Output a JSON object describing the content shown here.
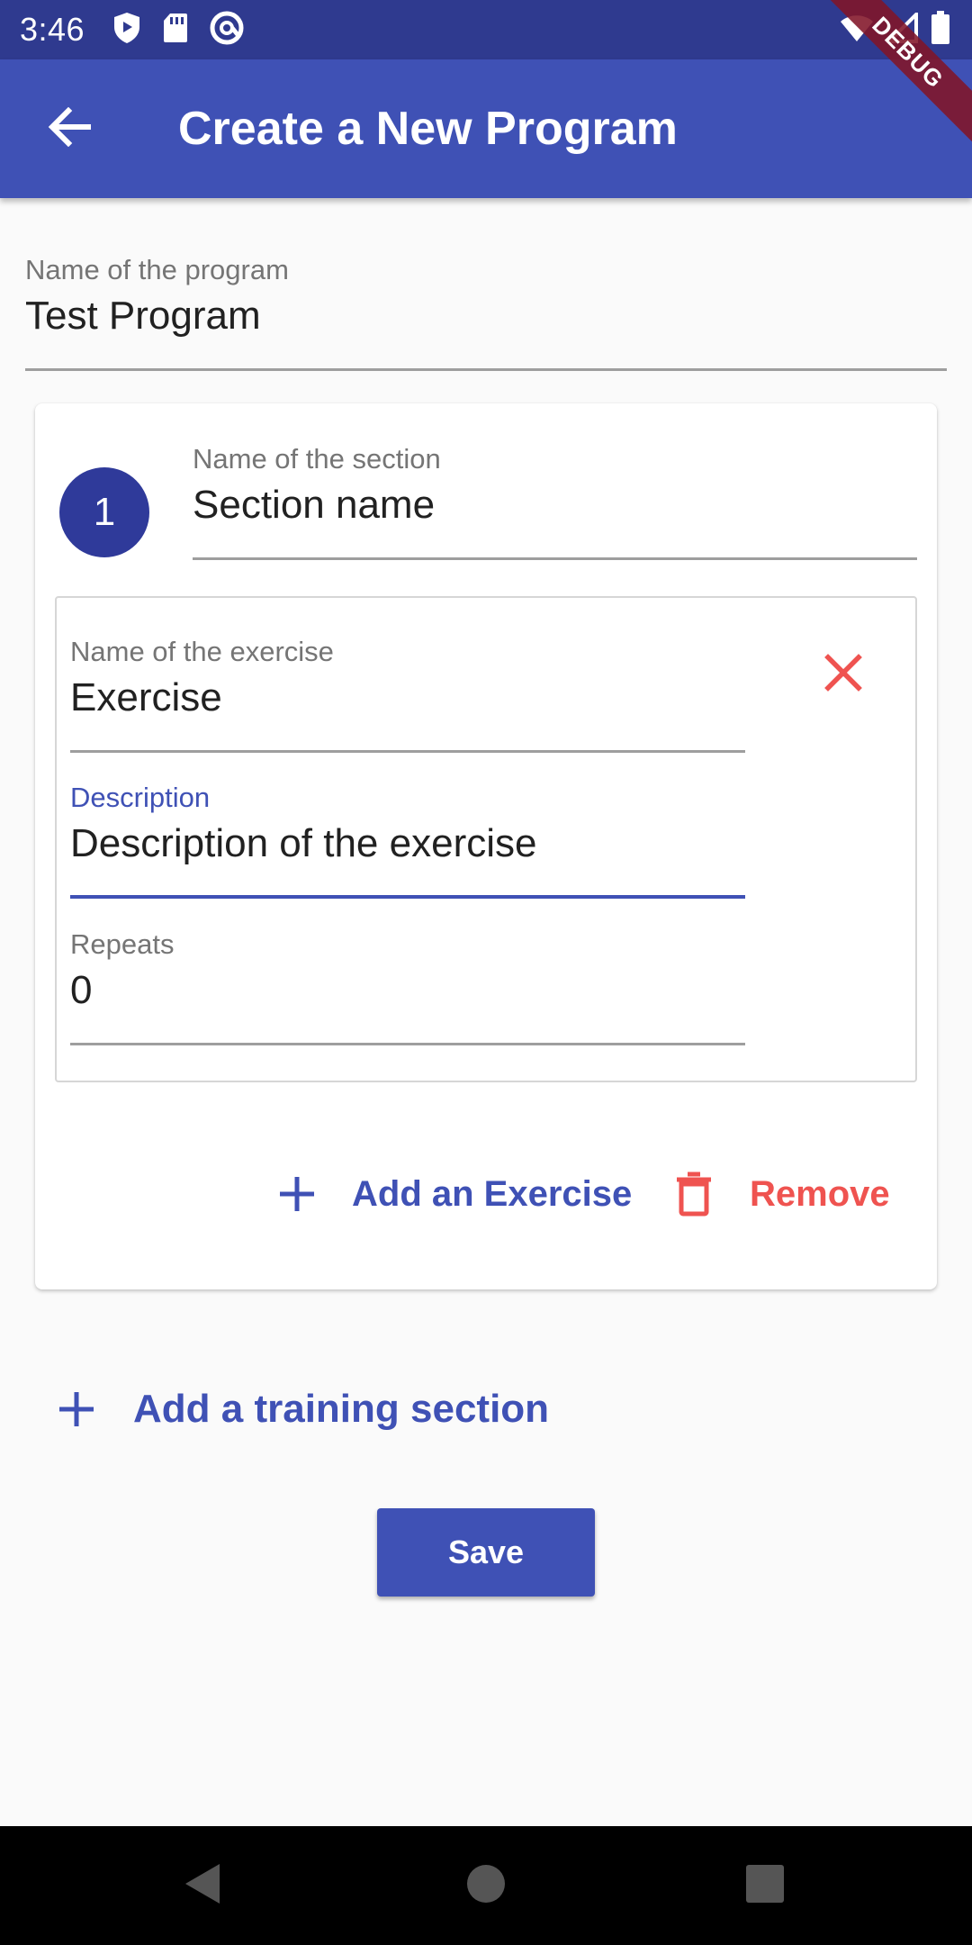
{
  "status_bar": {
    "time": "3:46",
    "left_icons": [
      "shield-icon",
      "sd-card-icon",
      "at-sign-icon"
    ],
    "right_icons": [
      "wifi-icon",
      "cell-signal-icon",
      "battery-icon"
    ]
  },
  "debug_banner": "DEBUG",
  "app_bar": {
    "title": "Create a New Program",
    "back_icon": "arrow-back-icon",
    "color": "#3f51b5"
  },
  "program": {
    "label": "Name of the program",
    "value": "Test Program"
  },
  "section": {
    "number": "1",
    "label": "Name of the section",
    "value": "Section name",
    "exercise": {
      "name_label": "Name of the exercise",
      "name_value": "Exercise",
      "description_label": "Description",
      "description_value": "Description of the exercise",
      "repeats_label": "Repeats",
      "repeats_value": "0"
    },
    "add_exercise_label": "Add an Exercise",
    "remove_label": "Remove"
  },
  "add_section_label": "Add a training section",
  "save_label": "Save",
  "colors": {
    "primary": "#3f51b5",
    "danger": "#ef5350"
  }
}
